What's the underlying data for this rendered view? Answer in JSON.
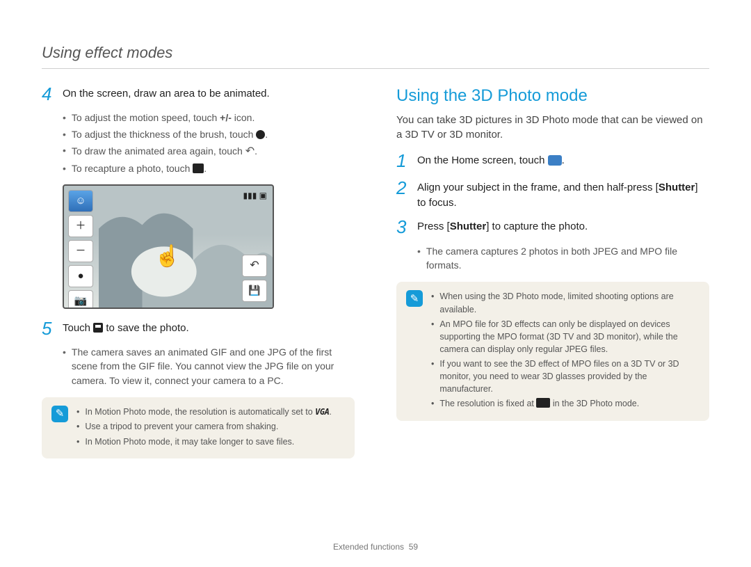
{
  "header": "Using effect modes",
  "left": {
    "step4": {
      "num": "4",
      "text": "On the screen, draw an area to be animated.",
      "bullets": [
        {
          "pre": "To adjust the motion speed, touch ",
          "icon": "+/-",
          "post": " icon."
        },
        {
          "pre": "To adjust the thickness of the brush, touch ",
          "icon": "●",
          "post": "."
        },
        {
          "pre": "To draw the animated area again, touch ",
          "icon": "↶",
          "post": "."
        },
        {
          "pre": "To recapture a photo, touch ",
          "icon": "📷",
          "post": "."
        }
      ]
    },
    "step5": {
      "num": "5",
      "text_pre": "Touch ",
      "text_post": " to save the photo.",
      "bullet": "The camera saves an animated GIF and one JPG of the first scene from the GIF file. You cannot view the JPG file on your camera. To view it, connect your camera to a PC."
    },
    "note": [
      {
        "pre": "In Motion Photo mode, the resolution is automatically set to ",
        "vga": "VGA",
        "post": "."
      },
      {
        "pre": "Use a tripod to prevent your camera from shaking.",
        "vga": "",
        "post": ""
      },
      {
        "pre": "In Motion Photo mode, it may take longer to save files.",
        "vga": "",
        "post": ""
      }
    ]
  },
  "right": {
    "heading": "Using the 3D Photo mode",
    "intro": "You can take 3D pictures in 3D Photo mode that can be viewed on a 3D TV or 3D monitor.",
    "step1": {
      "num": "1",
      "pre": "On the Home screen, touch ",
      "post": "."
    },
    "step2": {
      "num": "2",
      "text_a": "Align your subject in the frame, and then half-press [",
      "text_b": "Shutter",
      "text_c": "] to focus."
    },
    "step3": {
      "num": "3",
      "text_a": "Press [",
      "text_b": "Shutter",
      "text_c": "] to capture the photo.",
      "bullet": "The camera captures 2 photos in both JPEG and MPO file formats."
    },
    "note": [
      "When using the 3D Photo mode, limited shooting options are available.",
      "An MPO file for 3D effects can only be displayed on devices supporting the MPO format (3D TV and 3D monitor), while the camera can display only regular JPEG files.",
      "If you want to see the 3D effect of MPO files on a 3D TV or 3D monitor, you need to wear 3D glasses provided by the manufacturer."
    ],
    "note_last_pre": "The resolution is fixed at ",
    "note_last_post": " in the 3D Photo mode."
  },
  "footer": {
    "label": "Extended functions",
    "page": "59"
  }
}
